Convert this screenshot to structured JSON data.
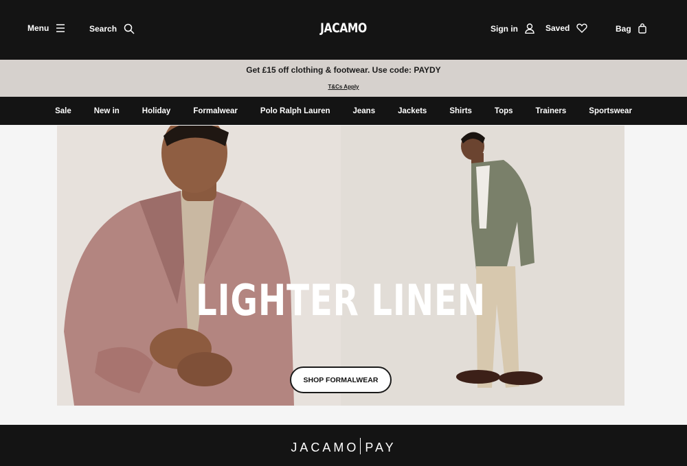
{
  "header": {
    "menu_label": "Menu",
    "search_label": "Search",
    "logo_text": "JACAMO",
    "signin_label": "Sign in",
    "saved_label": "Saved",
    "bag_label": "Bag"
  },
  "promo": {
    "message": "Get £15 off clothing & footwear. Use code: PAYDY",
    "terms": "T&Cs Apply"
  },
  "nav": {
    "items": [
      "Sale",
      "New in",
      "Holiday",
      "Formalwear",
      "Polo Ralph Lauren",
      "Jeans",
      "Jackets",
      "Shirts",
      "Tops",
      "Trainers",
      "Sportswear"
    ]
  },
  "hero": {
    "headline": "LIGHTER LINEN",
    "cta_label": "SHOP FORMALWEAR"
  },
  "footer": {
    "pay_left": "JACAMO",
    "pay_right": "PAY"
  },
  "colors": {
    "header_bg": "#141414",
    "promo_bg": "#d6d1cd",
    "hero_bg": "#e7e1dc"
  },
  "icons": [
    "hamburger-icon",
    "search-icon",
    "user-icon",
    "heart-icon",
    "bag-icon"
  ]
}
